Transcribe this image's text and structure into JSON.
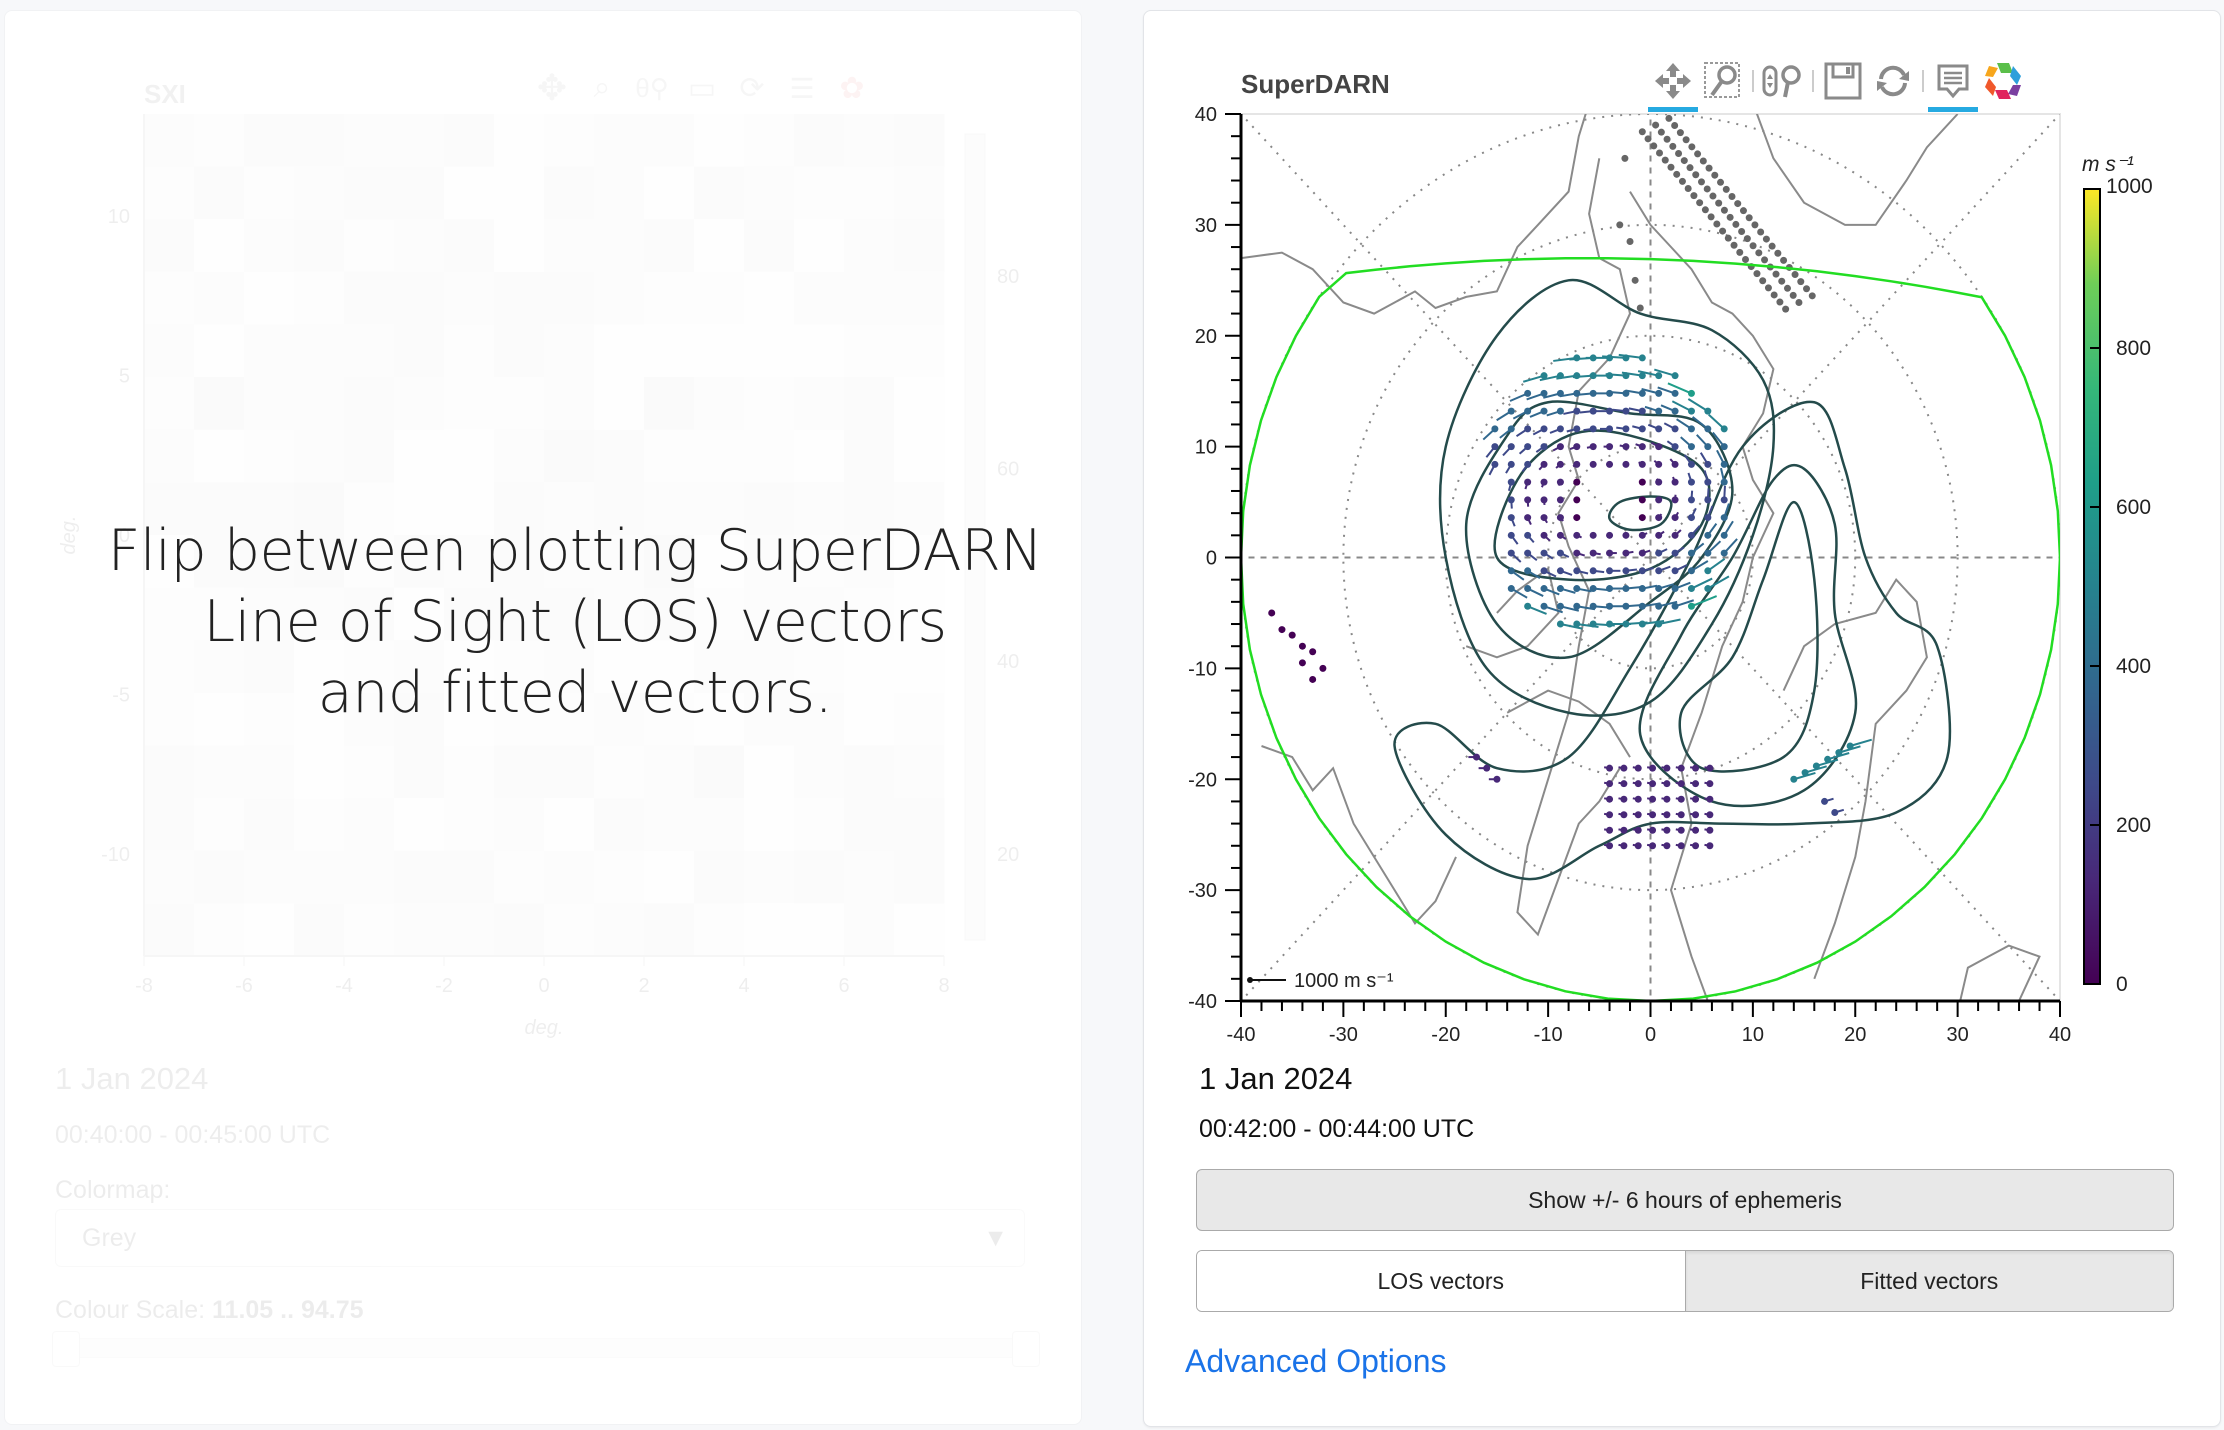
{
  "left_panel": {
    "title": "SXI",
    "x_axis_label": "deg.",
    "y_axis_label": "deg.",
    "x_ticks": [
      "-8",
      "-6",
      "-4",
      "-2",
      "0",
      "2",
      "4",
      "6",
      "8"
    ],
    "y_ticks": [
      "10",
      "5",
      "0",
      "-5",
      "-10"
    ],
    "colorbar_ticks": [
      "80",
      "60",
      "40",
      "20"
    ],
    "date": "1 Jan 2024",
    "time_range": "00:40:00 - 00:45:00 UTC",
    "colormap_label": "Colormap:",
    "colormap_value": "Grey",
    "colour_scale_label": "Colour Scale:",
    "colour_scale_value": "11.05 .. 94.75",
    "colour_scale_range": [
      11.05,
      94.75
    ]
  },
  "overlay": {
    "text_lines": [
      "Flip between plotting SuperDARN",
      "Line of Sight (LOS) vectors",
      "and fitted vectors."
    ]
  },
  "right_panel": {
    "title": "SuperDARN",
    "toolbar": [
      {
        "icon": "pan-icon",
        "label": "Pan",
        "active": true
      },
      {
        "icon": "box-zoom-icon",
        "label": "Box Zoom",
        "active": false
      },
      {
        "icon": "wheel-zoom-icon",
        "label": "Wheel Zoom",
        "active": false
      },
      {
        "icon": "save-icon",
        "label": "Save",
        "active": false
      },
      {
        "icon": "reset-icon",
        "label": "Reset",
        "active": false
      },
      {
        "icon": "hover-icon",
        "label": "Hover",
        "active": true
      },
      {
        "icon": "bokeh-logo-icon",
        "label": "Bokeh",
        "active": false
      }
    ],
    "colorbar": {
      "title": "m s⁻¹",
      "min": 0,
      "max": 1000,
      "ticks": [
        "1000",
        "800",
        "600",
        "400",
        "200",
        "0"
      ],
      "colormap": "viridis"
    },
    "scale_legend": "1000 m s⁻¹",
    "date": "1 Jan 2024",
    "time_range": "00:42:00 - 00:44:00 UTC",
    "ephemeris_button": "Show +/- 6 hours of ephemeris",
    "vector_mode": {
      "options": [
        "LOS vectors",
        "Fitted vectors"
      ],
      "selected": "Fitted vectors"
    },
    "advanced_options_link": "Advanced Options"
  },
  "chart_data": {
    "type": "scatter",
    "title": "SuperDARN",
    "xlabel": "",
    "ylabel": "",
    "xlim": [
      -40,
      40
    ],
    "ylim": [
      -40,
      40
    ],
    "x_ticks": [
      "-40",
      "-30",
      "-20",
      "-10",
      "0",
      "10",
      "20",
      "30",
      "40"
    ],
    "y_ticks": [
      "40",
      "30",
      "20",
      "10",
      "0",
      "-10",
      "-20",
      "-30",
      "-40"
    ],
    "grid": "polar dotted (latitude circles and meridians)",
    "colorbar_range": [
      0,
      1000
    ],
    "colorbar_label": "m s⁻¹",
    "series": [
      {
        "name": "Fitted velocity vectors",
        "description": "two-cell convection, fastest ~600 m/s near (5,10) and (17,-20)"
      },
      {
        "name": "Convection potential contours",
        "color": "#244b4b"
      },
      {
        "name": "Heppner-Maynard boundary",
        "color": "#22dd22"
      },
      {
        "name": "Satellite footprint ephemeris (grey dots)",
        "color": "#666666"
      },
      {
        "name": "Coastlines",
        "color": "#888888"
      }
    ],
    "annotations": [
      "1000 m s⁻¹ scale vector"
    ]
  }
}
